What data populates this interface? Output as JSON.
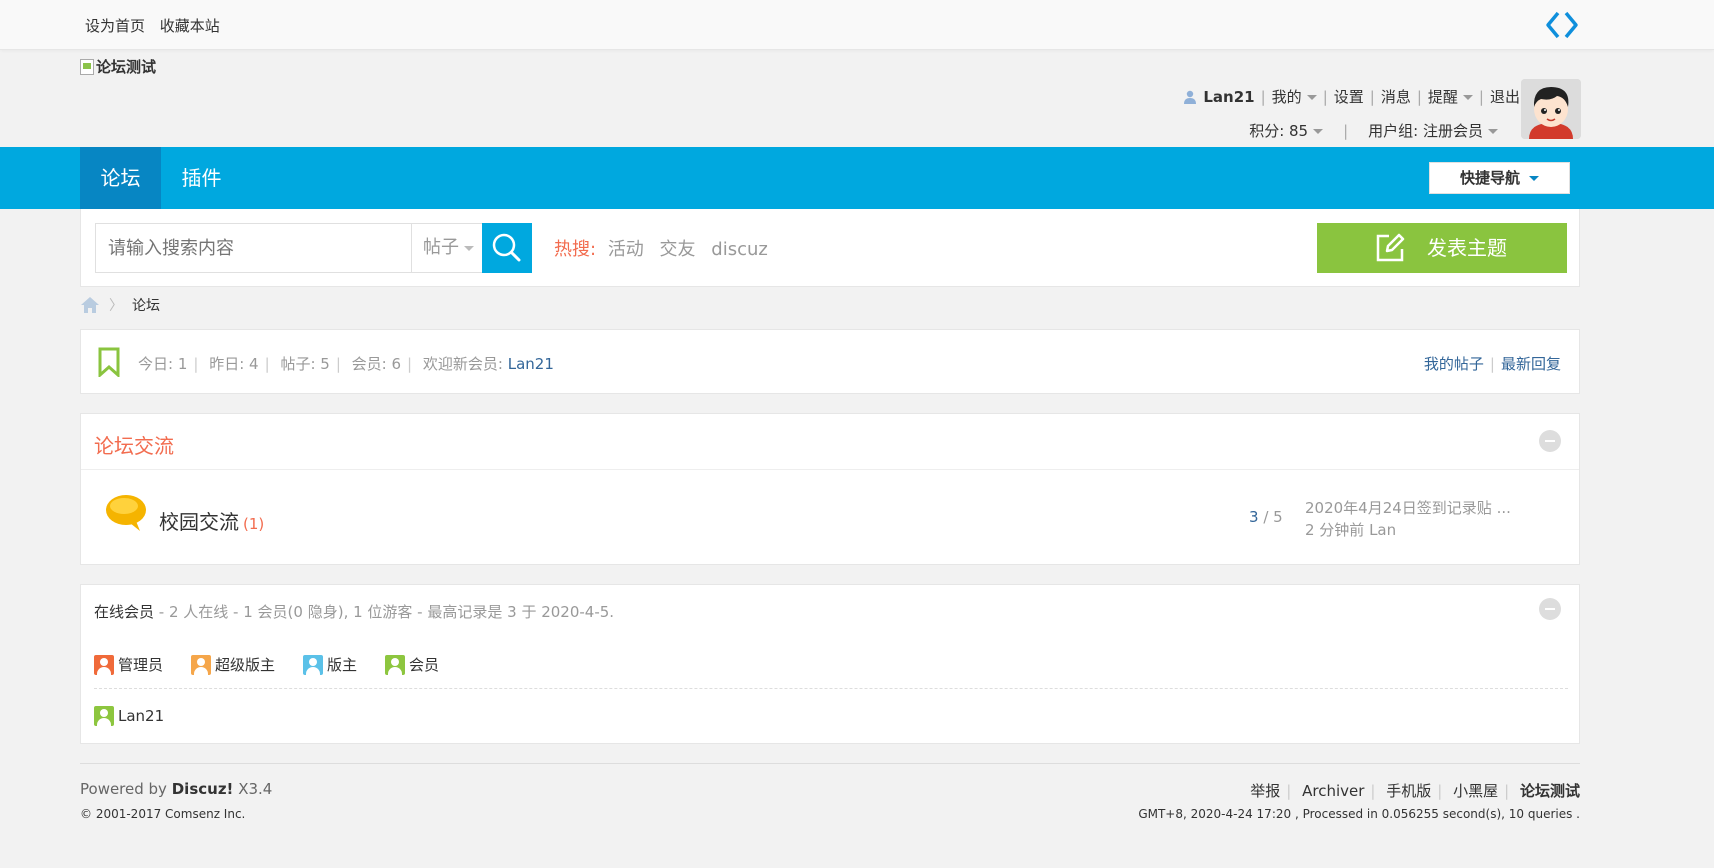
{
  "topbar": {
    "set_home": "设为首页",
    "bookmark": "收藏本站",
    "code_icon": "code-brackets-icon"
  },
  "logo": {
    "alt_text": "论坛测试"
  },
  "user": {
    "username": "Lan21",
    "my": "我的",
    "settings": "设置",
    "messages": "消息",
    "reminders": "提醒",
    "logout": "退出",
    "credits_label": "积分: 85",
    "group_label": "用户组: 注册会员"
  },
  "nav": {
    "tabs": [
      {
        "label": "论坛",
        "active": true
      },
      {
        "label": "插件",
        "active": false
      }
    ],
    "quick_nav": "快捷导航"
  },
  "search": {
    "placeholder": "请输入搜索内容",
    "type": "帖子",
    "hot_label": "热搜:",
    "hot_words": [
      "活动",
      "交友",
      "discuz"
    ],
    "post_button": "发表主题"
  },
  "breadcrumb": {
    "current": "论坛"
  },
  "stats": {
    "today": "今日: 1",
    "yesterday": "昨日: 4",
    "posts": "帖子: 5",
    "members": "会员: 6",
    "welcome": "欢迎新会员:",
    "new_member": "Lan21",
    "my_posts": "我的帖子",
    "latest_replies": "最新回复"
  },
  "category": {
    "title": "论坛交流",
    "forums": [
      {
        "name": "校园交流",
        "count": "(1)",
        "threads": "3",
        "posts": "5",
        "last_title": "2020年4月24日签到记录贴 ...",
        "last_info": "2 分钟前 Lan"
      }
    ]
  },
  "online": {
    "label": "在线会员",
    "summary": "- 2 人在线 - 1 会员(0 隐身), 1 位游客 - 最高记录是 3 于 2020-4-5.",
    "legend": [
      {
        "label": "管理员",
        "color": "#f06a3a"
      },
      {
        "label": "超级版主",
        "color": "#f5a64a"
      },
      {
        "label": "版主",
        "color": "#5bc1e8"
      },
      {
        "label": "会员",
        "color": "#8dc63f"
      }
    ],
    "members": [
      "Lan21"
    ]
  },
  "footer": {
    "powered_prefix": "Powered by",
    "brand": "Discuz!",
    "version": "X3.4",
    "copyright": "© 2001-2017 Comsenz Inc.",
    "links": [
      "举报",
      "Archiver",
      "手机版",
      "小黑屋",
      "论坛测试"
    ],
    "gmt": "GMT+8, 2020-4-24 17:20 , Processed in 0.056255 second(s), 10 queries ."
  },
  "colors": {
    "nav_blue": "#00a8df",
    "nav_active": "#0786c3",
    "post_green": "#8ac43f",
    "accent_orange": "#f26c4f",
    "link_blue": "#336699"
  }
}
